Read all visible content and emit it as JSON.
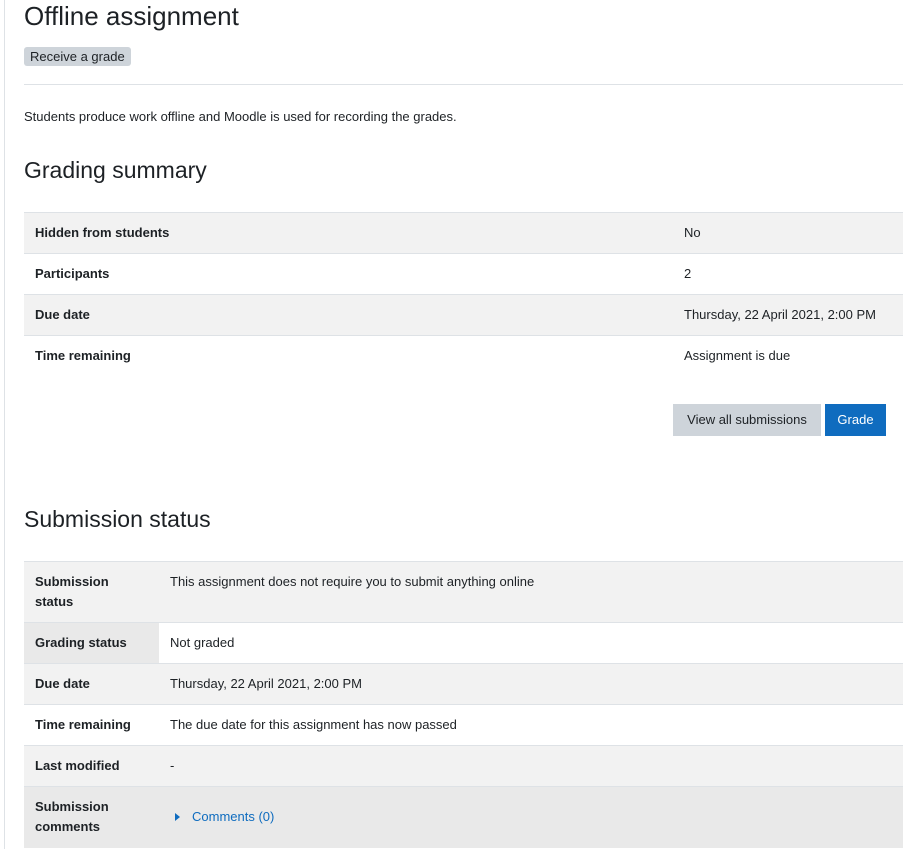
{
  "page": {
    "title": "Offline assignment",
    "badge": "Receive a grade",
    "intro": "Students produce work offline and Moodle is used for recording the grades."
  },
  "grading_summary": {
    "heading": "Grading summary",
    "rows": [
      {
        "label": "Hidden from students",
        "value": "No"
      },
      {
        "label": "Participants",
        "value": "2"
      },
      {
        "label": "Due date",
        "value": "Thursday, 22 April 2021, 2:00 PM"
      },
      {
        "label": "Time remaining",
        "value": "Assignment is due"
      }
    ],
    "buttons": {
      "view_all": "View all submissions",
      "grade": "Grade"
    }
  },
  "submission_status": {
    "heading": "Submission status",
    "rows": [
      {
        "label": "Submission status",
        "value": "This assignment does not require you to submit anything online"
      },
      {
        "label": "Grading status",
        "value": "Not graded"
      },
      {
        "label": "Due date",
        "value": "Thursday, 22 April 2021, 2:00 PM"
      },
      {
        "label": "Time remaining",
        "value": "The due date for this assignment has now passed"
      },
      {
        "label": "Last modified",
        "value": "-"
      },
      {
        "label": "Submission comments",
        "value": "Comments (0)"
      }
    ]
  },
  "colors": {
    "primary": "#0f6cbf",
    "secondary": "#ced4da",
    "row_stripe": "#f2f2f2"
  }
}
